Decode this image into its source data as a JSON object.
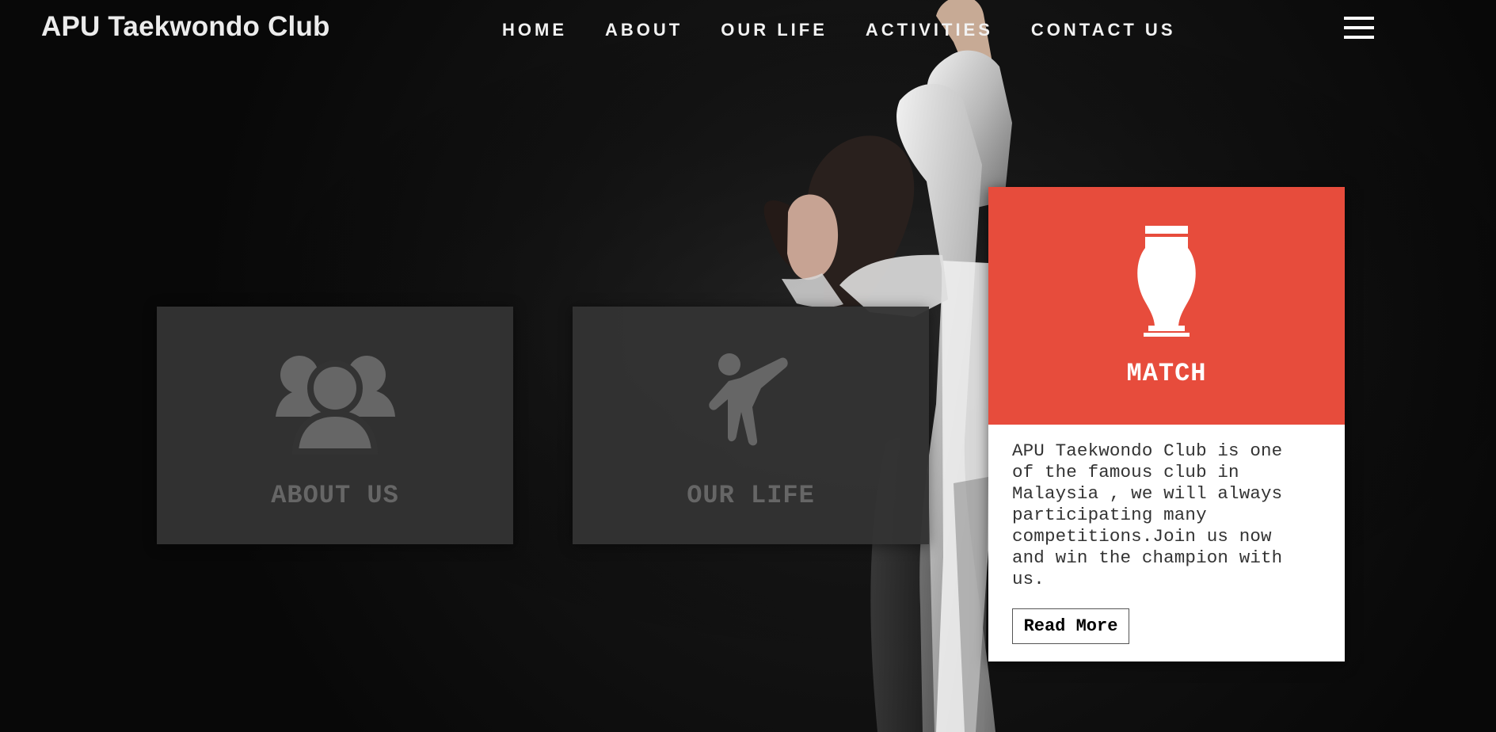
{
  "brand": {
    "name": "APU Taekwondo Club"
  },
  "nav": {
    "items": [
      {
        "label": "HOME"
      },
      {
        "label": "ABOUT"
      },
      {
        "label": "OUR LIFE"
      },
      {
        "label": "ACTIVITIES"
      },
      {
        "label": "CONTACT US"
      }
    ],
    "menu_icon": "hamburger-menu-icon"
  },
  "cards": {
    "about": {
      "title": "ABOUT US",
      "icon": "group-users-icon"
    },
    "life": {
      "title": "OUR LIFE",
      "icon": "kick-figure-icon"
    },
    "match": {
      "title": "MATCH",
      "icon": "trophy-icon",
      "description": "APU Taekwondo Club is one of the famous club in Malaysia , we will always participating many competitions.Join us now and win the champion with us.",
      "button_label": "Read More"
    }
  },
  "colors": {
    "accent": "#e74c3c",
    "card_gray": "#333333",
    "muted_text": "#666666",
    "white": "#ffffff"
  }
}
